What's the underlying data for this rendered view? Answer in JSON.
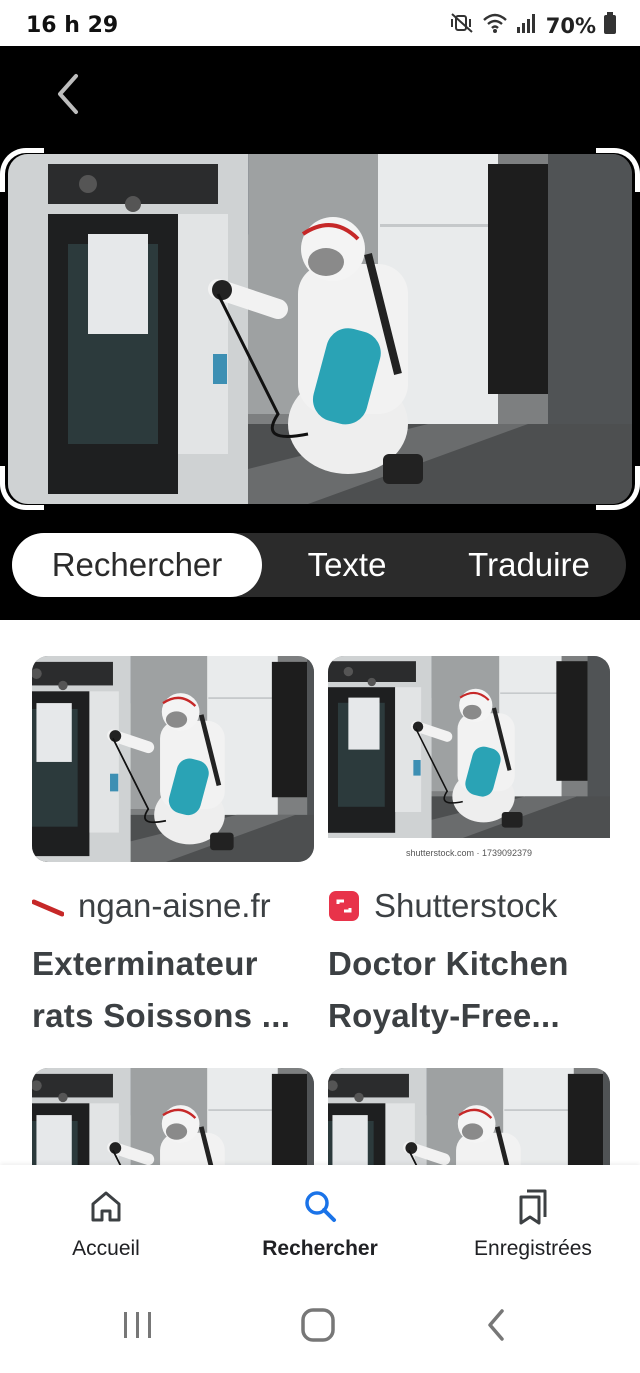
{
  "status_bar": {
    "time": "16 h 29",
    "battery_percent": "70%",
    "icons": [
      "mute-vibrate-icon",
      "wifi-icon",
      "signal-icon",
      "battery-icon"
    ]
  },
  "lens": {
    "back_icon": "chevron-left-icon",
    "tabs": [
      {
        "label": "Rechercher",
        "active": true
      },
      {
        "label": "Texte",
        "active": false
      },
      {
        "label": "Traduire",
        "active": false
      }
    ]
  },
  "results": [
    {
      "source": "ngan-aisne.fr",
      "source_icon": "red-slash-favicon",
      "title_line1": "Exterminateur",
      "title_line2": "rats Soissons ..."
    },
    {
      "source": "Shutterstock",
      "source_icon": "shutterstock-favicon",
      "watermark": "shutterstock.com · 1739092379",
      "title_line1": "Doctor Kitchen",
      "title_line2": "Royalty-Free..."
    }
  ],
  "bottom_nav": [
    {
      "label": "Accueil",
      "icon": "home-icon",
      "active": false
    },
    {
      "label": "Rechercher",
      "icon": "search-icon",
      "active": true
    },
    {
      "label": "Enregistrées",
      "icon": "bookmarks-icon",
      "active": false
    }
  ],
  "system_nav": [
    "recents-icon",
    "home-button-icon",
    "back-icon"
  ],
  "colors": {
    "accent": "#1a73e8",
    "header_bg": "#000000",
    "tab_bg": "#2b2b2b"
  }
}
